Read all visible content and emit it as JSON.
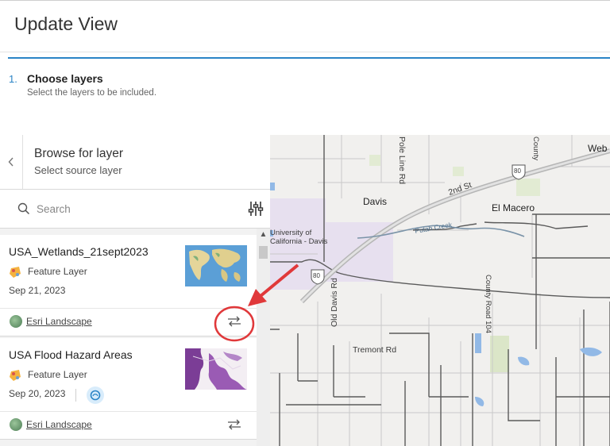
{
  "header": {
    "title": "Update View"
  },
  "step": {
    "number": "1.",
    "title": "Choose layers",
    "description": "Select the layers to be included."
  },
  "panel": {
    "title": "Browse for layer",
    "subtitle": "Select source layer",
    "back_icon": "chevron-left-icon",
    "search": {
      "placeholder": "Search",
      "value": "",
      "icon": "search-icon"
    },
    "filter_icon": "filter-sliders-icon"
  },
  "layers": [
    {
      "title": "USA_Wetlands_21sept2023",
      "type": "Feature Layer",
      "date": "Sep 21, 2023",
      "owner": "Esri Landscape",
      "action_icon": "swap-icon"
    },
    {
      "title": "USA Flood Hazard Areas",
      "type": "Feature Layer",
      "date": "Sep 20, 2023",
      "owner": "Esri Landscape",
      "badge_icon": "living-atlas-icon",
      "action_icon": "swap-icon"
    }
  ],
  "map": {
    "labels": {
      "davis": "Davis",
      "el_macero": "El Macero",
      "university": "University of",
      "university2": "California - Davis",
      "second_st": "2nd St",
      "pole_line_rd": "Pole Line Rd",
      "old_davis_rd": "Old Davis Rd",
      "tremont_rd": "Tremont Rd",
      "county_road": "County Road 104",
      "putah_creek": "Putah Creek",
      "county": "County",
      "web": "Web",
      "i80_a": "80",
      "i80_b": "80"
    }
  },
  "colors": {
    "accent": "#2a84c6",
    "annotation": "#e0383a"
  }
}
